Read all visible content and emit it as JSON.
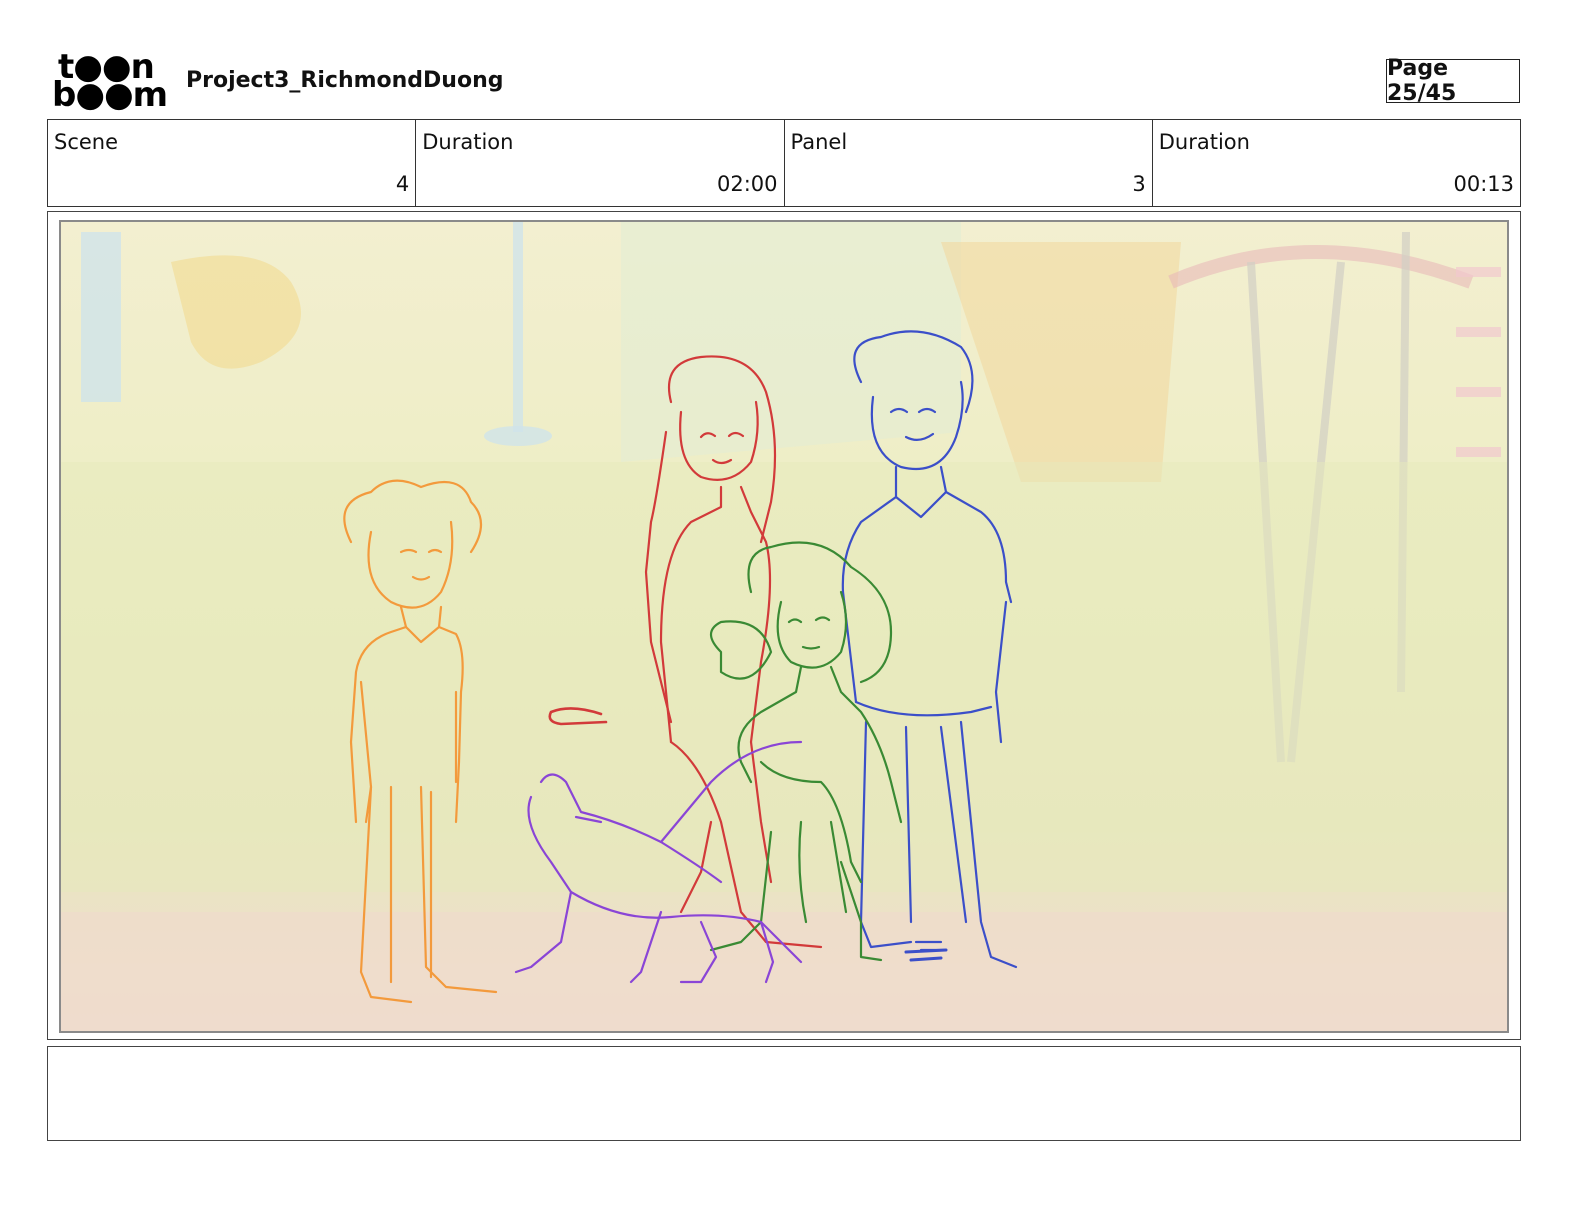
{
  "header": {
    "logo_top": "t●●n",
    "logo_bottom": "b●●m",
    "project_title": "Project3_RichmondDuong",
    "page_label": "Page 25/45"
  },
  "info": {
    "scene_label": "Scene",
    "scene_value": "4",
    "scene_duration_label": "Duration",
    "scene_duration_value": "02:00",
    "panel_label": "Panel",
    "panel_value": "3",
    "panel_duration_label": "Duration",
    "panel_duration_value": "00:13"
  },
  "panel": {
    "colors": {
      "boy": "#f39a3c",
      "girl_tall": "#d23a3a",
      "man": "#3b4fc9",
      "girl_small": "#3a8a34",
      "dog": "#8a45d6"
    }
  },
  "notes": {
    "text": ""
  }
}
